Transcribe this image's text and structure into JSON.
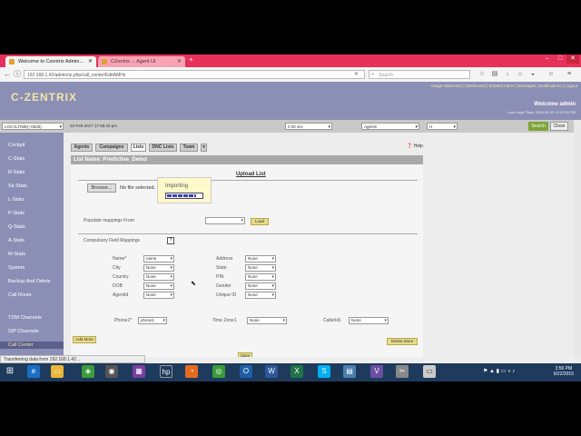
{
  "browser": {
    "tabs": [
      {
        "title": "Welcome to Czentrix Admin...",
        "active": true
      },
      {
        "title": "CZentrix ... Agent UI",
        "active": false
      }
    ],
    "new_tab": "+",
    "url": "192.168.1.42/admin/ui.php/call_center/EditAMHx",
    "search_placeholder": "Search",
    "status": "Transferring data from 192.168.1.42..."
  },
  "header": {
    "logo": "C-ZENTRIX",
    "links": "Usage Statement | Dashboard | Subtest Alerts | Messages | Notifications | Logout",
    "welcome": "Welcome admin",
    "last_login": "Last Login Time: 2015-06-23 12:22:06 PM"
  },
  "filterbar": {
    "timezone": "LOCALTIME(+0530)",
    "date": "22-Feb-2017 17:58:43 pm",
    "num": "0 00 sec",
    "agents": "Agents",
    "num2": "H",
    "search_label": "Search",
    "close_label": "Close"
  },
  "sidebar": {
    "items": [
      {
        "label": "Cockpit"
      },
      {
        "label": "C-Stats"
      },
      {
        "label": "R-Stats"
      },
      {
        "label": "Sk-Stats"
      },
      {
        "label": "L-Stats"
      },
      {
        "label": "P-Stats"
      },
      {
        "label": "Q-Stats"
      },
      {
        "label": "A-Stats"
      },
      {
        "label": "M-Stats"
      },
      {
        "label": "System"
      },
      {
        "label": "Backup And Delete"
      },
      {
        "label": "Call Route"
      },
      {
        "label": "TDM Channels"
      },
      {
        "label": "SIP Channels"
      },
      {
        "label": "Call Center"
      }
    ]
  },
  "tabs": [
    {
      "label": "Agents"
    },
    {
      "label": "Campaigns"
    },
    {
      "label": "Lists"
    },
    {
      "label": "DNC Lists"
    },
    {
      "label": "Team"
    }
  ],
  "help_label": "Help",
  "panel": {
    "list_name": "List Name: Predictive_Demo",
    "upload_title": "Upload List",
    "browse": "Browse...",
    "no_file": "No file selected.",
    "importing": "Importing",
    "import_progress": 0.85,
    "populate_label": "Populate mappings From",
    "load_btn": "Load",
    "compulsory_label": "Compulsory Field Mappings",
    "help_q": "?",
    "fields_left": [
      {
        "label": "Name*",
        "value": "name"
      },
      {
        "label": "City",
        "value": "None"
      },
      {
        "label": "Country",
        "value": "None"
      },
      {
        "label": "DOB",
        "value": "None"
      },
      {
        "label": "AgentId",
        "value": "None"
      }
    ],
    "fields_right": [
      {
        "label": "Address",
        "value": "None"
      },
      {
        "label": "State",
        "value": "None"
      },
      {
        "label": "PIN",
        "value": "None"
      },
      {
        "label": "Gender",
        "value": "None"
      },
      {
        "label": "Unique ID",
        "value": "None"
      }
    ],
    "phone_label": "Phone1*",
    "phone_value": "phone1",
    "tz_label": "Time Zone1",
    "tz_value": "None",
    "callerid_label": "CallerId1",
    "callerid_value": "None",
    "add_more": "Add More",
    "delete_more": "Delete More",
    "save": "Save"
  },
  "taskbar": {
    "time": "3:56 PM",
    "date": "6/22/2015"
  }
}
